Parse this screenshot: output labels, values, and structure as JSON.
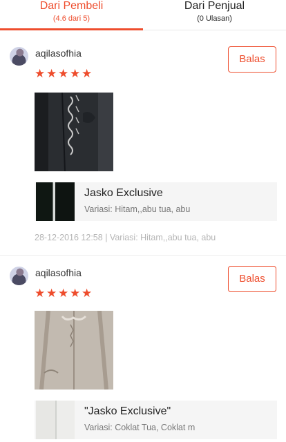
{
  "tabs": [
    {
      "label": "Dari Pembeli",
      "sub": "(4.6 dari 5)",
      "active": true
    },
    {
      "label": "Dari Penjual",
      "sub": "(0 Ulasan)",
      "active": false
    }
  ],
  "reviews": [
    {
      "username": "aqilasofhia",
      "rating": 5,
      "reply_label": "Balas",
      "product_name": "Jasko Exclusive",
      "variation": "Variasi: Hitam,,abu tua, abu",
      "date": "28-12-2016 12:58",
      "meta_variation": "Variasi:  Hitam,,abu tua, abu"
    },
    {
      "username": "aqilasofhia",
      "rating": 5,
      "reply_label": "Balas",
      "product_name": "\"Jasko Exclusive\"",
      "variation": "Variasi: Coklat Tua, Coklat m"
    }
  ],
  "colors": {
    "accent": "#ee4d2d"
  }
}
